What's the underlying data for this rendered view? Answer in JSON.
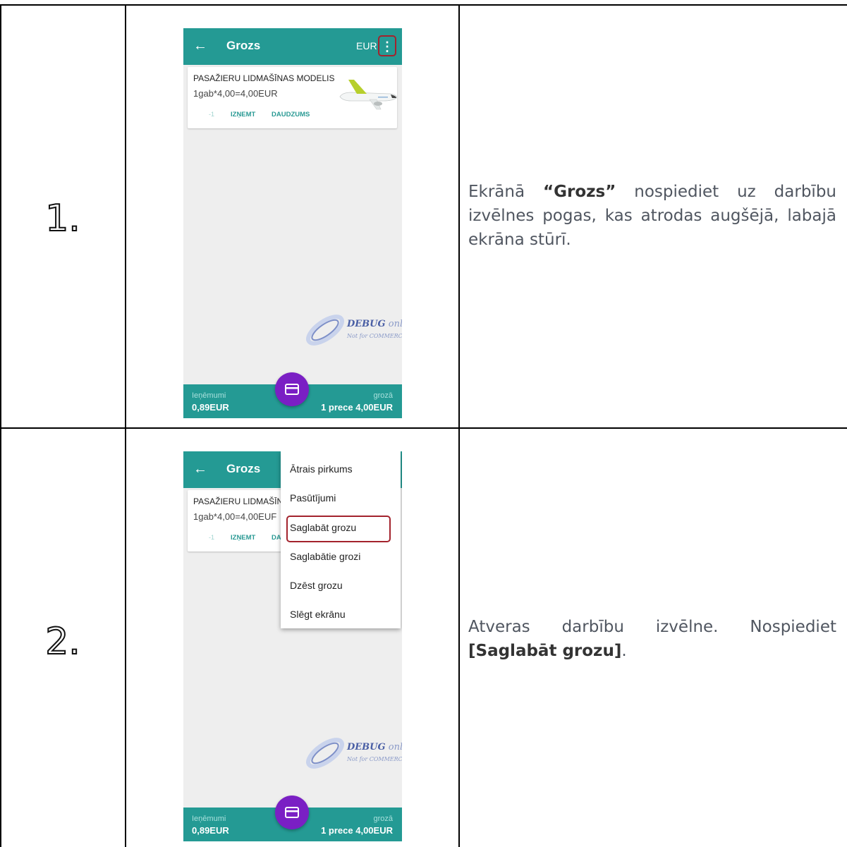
{
  "steps": [
    {
      "number": "1.",
      "description": {
        "part1": "Ekrānā ",
        "bold1": "“Grozs”",
        "part2": " nospiediet uz darbību izvēlnes pogas, kas atrodas augšējā, labajā ekrāna stūrī."
      }
    },
    {
      "number": "2.",
      "description": {
        "part1": "Atveras darbību izvēlne. Nospiediet ",
        "bold1": "[Saglabāt grozu]",
        "part2": "."
      }
    }
  ],
  "app": {
    "back_icon": "←",
    "title": "Grozs",
    "currency": "EUR",
    "more_icon": "⋮",
    "item": {
      "name": "PASAŽIERU LIDMAŠĪNAS MODELIS",
      "name_truncated": "PASAŽIERU LIDMAŠĪN",
      "calc": "1gab*4,00=4,00EUR",
      "calc_truncated": "1gab*4,00=4,00EUF",
      "minus": "-1",
      "remove": "IZŅEMT",
      "quantity": "DAUDZUMS",
      "quantity_truncated": "DA"
    },
    "watermark": {
      "line1": "DEBUG",
      "line1_suffix": " only",
      "line2": "Not for COMMERCIAL"
    },
    "bottom": {
      "left_label": "Ieņēmumi",
      "left_value": "0,89EUR",
      "right_label": "grozā",
      "right_value": "1 prece 4,00EUR"
    },
    "menu": [
      "Ātrais pirkums",
      "Pasūtījumi",
      "Saglabāt grozu",
      "Saglabātie grozi",
      "Dzēst grozu",
      "Slēgt ekrānu"
    ]
  },
  "colors": {
    "appbar": "#249a94",
    "fab": "#7a1fc4",
    "highlight": "#a3232d"
  }
}
